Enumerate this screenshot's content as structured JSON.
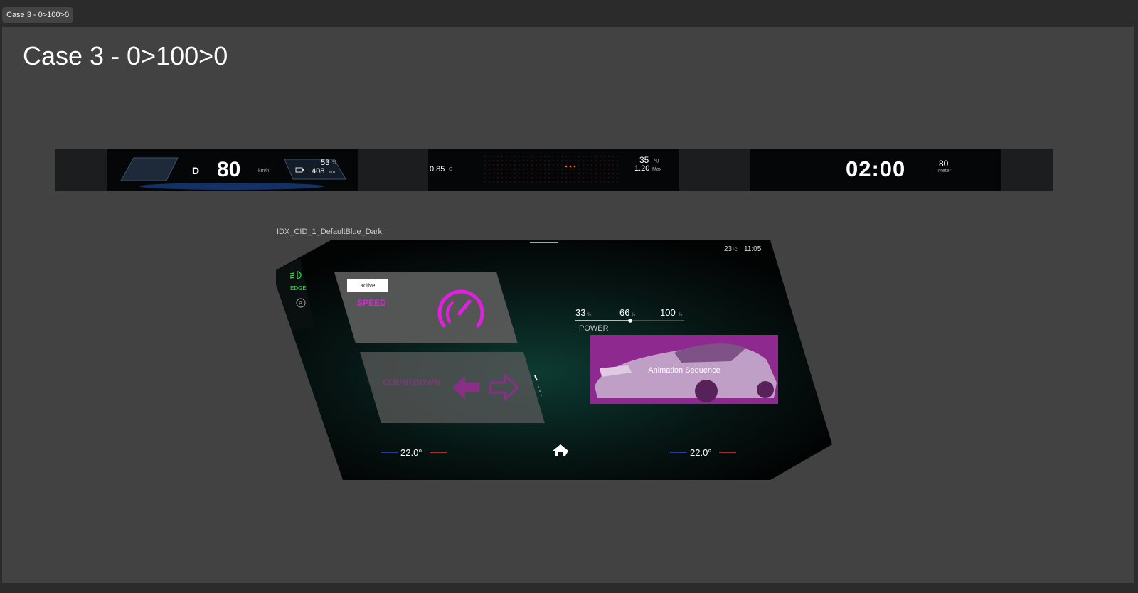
{
  "frame_tag": "Case 3 - 0>100>0",
  "page_title": "Case 3 - 0>100>0",
  "cluster": {
    "gear": "D",
    "speed": "80",
    "speed_unit": "km/h",
    "battery_percent": "53",
    "battery_percent_unit": "%",
    "range": "408",
    "range_unit": "km",
    "g_force": "0.85",
    "g_unit": "G",
    "weight": "35",
    "weight_unit": "kg",
    "max_g": "1.20",
    "max_unit": "Max",
    "timer": "02:00",
    "distance": "80",
    "distance_unit": "meter"
  },
  "cid": {
    "frame_label": "IDX_CID_1_DefaultBlue_Dark",
    "outside_temp": "23",
    "outside_temp_unit": "°C",
    "clock": "11:05",
    "active_badge": "active",
    "speed_label": "SPEED",
    "countdown_label": "COUNTDOWN",
    "power_levels": [
      "33",
      "66",
      "100"
    ],
    "power_unit": "%",
    "power_label": "POWER",
    "animation_label": "Animation Sequence",
    "temp_left": "22.0°",
    "temp_right": "22.0°",
    "colors": {
      "accent_magenta": "#e21fe0",
      "indicator_green": "#3ddc4b",
      "climate_blue": "#2f4ad8",
      "climate_red": "#d8383a"
    }
  }
}
